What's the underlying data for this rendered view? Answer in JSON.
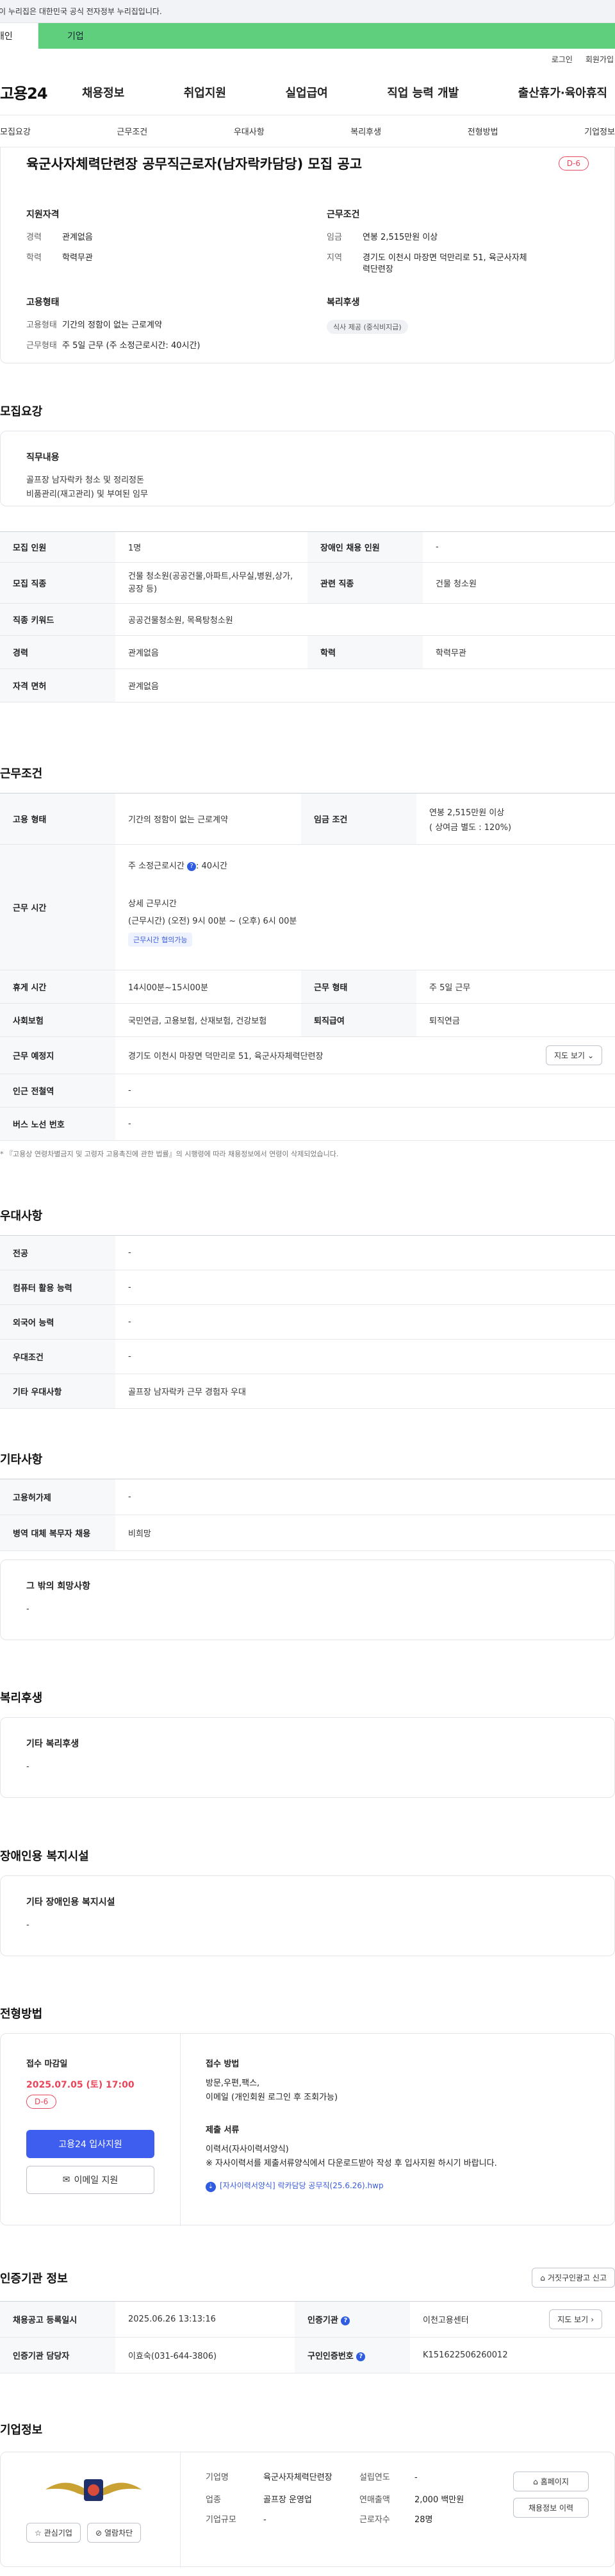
{
  "gov_bar": "이 누리집은 대한민국 공식 전자정부 누리집입니다.",
  "tabs": {
    "individual": "개인",
    "company": "기업"
  },
  "util": {
    "login": "로그인",
    "signup": "회원가입"
  },
  "logo": "고용24",
  "gnb": [
    "채용정보",
    "취업지원",
    "실업급여",
    "직업 능력 개발",
    "출산휴가·육아휴직"
  ],
  "anchors": [
    "모집요강",
    "근무조건",
    "우대사항",
    "복리후생",
    "전형방법",
    "기업정보"
  ],
  "hero": {
    "title": "육군사자체력단련장 공무직근로자(남자락카담당) 모집 공고",
    "dday": "D-6",
    "qualification_title": "지원자격",
    "career_k": "경력",
    "career_v": "관계없음",
    "edu_k": "학력",
    "edu_v": "학력무관",
    "conditions_title": "근무조건",
    "wage_k": "임금",
    "wage_v": "연봉 2,515만원 이상",
    "region_k": "지역",
    "region_v": "경기도 이천시 마장면 덕만리로 51, 육군사자체력단련장",
    "emp_title": "고용형태",
    "emp_k": "고용형태",
    "emp_v": "기간의 정함이 없는 근로계약",
    "hours_k": "근무형태",
    "hours_v": "주 5일 근무 (주 소정근로시간: 40시간)",
    "welfare_title": "복리후생",
    "welfare_chip": "식사 제공 (중식비지급)"
  },
  "recruit": {
    "section_title": "모집요강",
    "duty_title": "직무내용",
    "duty_lines": [
      "골프장 남자락카 청소 및 정리정돈",
      "비품관리(재고관리) 및 부여된 임무"
    ],
    "rows": {
      "count_k": "모집 인원",
      "count_v": "1명",
      "disabled_k": "장애인 채용 인원",
      "disabled_v": "-",
      "job_k": "모집 직종",
      "job_v": "건물 청소원(공공건물,아파트,사무실,병원,상가,공장 등)",
      "related_k": "관련 직종",
      "related_v": "건물 청소원",
      "keyword_k": "직종 키워드",
      "keyword_v": "공공건물청소원, 목욕탕청소원",
      "career_k": "경력",
      "career_v": "관계없음",
      "edu_k": "학력",
      "edu_v": "학력무관",
      "license_k": "자격 면허",
      "license_v": "관계없음"
    }
  },
  "work": {
    "section_title": "근무조건",
    "emp_k": "고용 형태",
    "emp_v": "기간의 정함이 없는 근로계약",
    "wage_k": "임금 조건",
    "wage_v1": "연봉 2,515만원 이상",
    "wage_v2": "( 상여금 별도 : 120%)",
    "time_k": "근무 시간",
    "time_main": "주 소정근로시간",
    "time_hours": ": 40시간",
    "time_detail_title": "상세 근무시간",
    "time_detail": "(근무시간) (오전) 9시 00분 ~ (오후) 6시 00분",
    "time_chip": "근무시간 협의가능",
    "rest_k": "휴게 시간",
    "rest_v": "14시00분~15시00분",
    "type_k": "근무 형태",
    "type_v": "주 5일 근무",
    "insurance_k": "사회보험",
    "insurance_v": "국민연금, 고용보험, 산재보험, 건강보험",
    "retire_k": "퇴직급여",
    "retire_v": "퇴직연금",
    "place_k": "근무 예정지",
    "place_v": "경기도 이천시 마장면 덕만리로 51, 육군사자체력단련장",
    "map_btn": "지도 보기",
    "subway_k": "인근 전철역",
    "subway_v": "-",
    "bus_k": "버스 노선 번호",
    "bus_v": "-",
    "note": "* 『고용상 연령차별금지 및 고령자 고용촉진에 관한 법률』의 시행령에 따라 채용정보에서 연령이 삭제되었습니다."
  },
  "preference": {
    "section_title": "우대사항",
    "major_k": "전공",
    "major_v": "-",
    "computer_k": "컴퓨터 활용 능력",
    "computer_v": "-",
    "lang_k": "외국어 능력",
    "lang_v": "-",
    "cond_k": "우대조건",
    "cond_v": "-",
    "etc_k": "기타 우대사항",
    "etc_v": "골프장 남자락카 근무 경험자 우대"
  },
  "other": {
    "section_title": "기타사항",
    "foreign_k": "고용허가제",
    "foreign_v": "-",
    "military_k": "병역 대체 복무자 채용",
    "military_v": "비희망",
    "etc_title": "그 밖의 희망사항",
    "etc_v": "-"
  },
  "welfare": {
    "section_title": "복리후생",
    "box_title": "기타 복리후생",
    "box_v": "-"
  },
  "disabled": {
    "section_title": "장애인용 복지시설",
    "box_title": "기타 장애인용 복지시설",
    "box_v": "-"
  },
  "selection": {
    "section_title": "전형방법",
    "deadline_title": "접수 마감일",
    "deadline": "2025.07.05 (토) 17:00",
    "dday": "D-6",
    "apply_btn": "고용24 입사지원",
    "email_btn": "이메일 지원",
    "method_title": "접수 방법",
    "method_v1": "방문,우편,팩스,",
    "method_v2": "이메일 (개인회원 로그인 후 조회가능)",
    "docs_title": "제출 서류",
    "docs_v1": "이력서(자사이력서양식)",
    "docs_v2": "※ 자사이력서를 제출서류양식에서 다운로드받아 작성 후 입사지원 하시기 바랍니다.",
    "file": "[자사이력서양식] 락카담당 공무직(25.6.26).hwp"
  },
  "agency": {
    "section_title": "인증기관 정보",
    "report_btn": "거짓구인광고 신고",
    "reg_k": "채용공고 등록일시",
    "reg_v": "2025.06.26 13:13:16",
    "org_k": "인증기관",
    "org_v": "이천고용센터",
    "map_btn": "지도 보기",
    "manager_k": "인증기관 담당자",
    "manager_v": "이효숙(031-644-3806)",
    "id_k": "구인인증번호",
    "id_v": "K151622506260012"
  },
  "company": {
    "section_title": "기업정보",
    "interest_btn": "관심기업",
    "block_btn": "열람차단",
    "name_k": "기업명",
    "name_v": "육군사자체력단련장",
    "industry_k": "업종",
    "industry_v": "골프장 운영업",
    "size_k": "기업규모",
    "size_v": "-",
    "founded_k": "설립연도",
    "founded_v": "-",
    "sales_k": "연매출액",
    "sales_v": "2,000 백만원",
    "staff_k": "근로자수",
    "staff_v": "28명",
    "home_btn": "홈페이지",
    "history_btn": "채용정보 이력"
  },
  "colors": {
    "accent": "#3e5ef0",
    "dday": "#e8455a",
    "tab_green": "#5fcf7d"
  }
}
